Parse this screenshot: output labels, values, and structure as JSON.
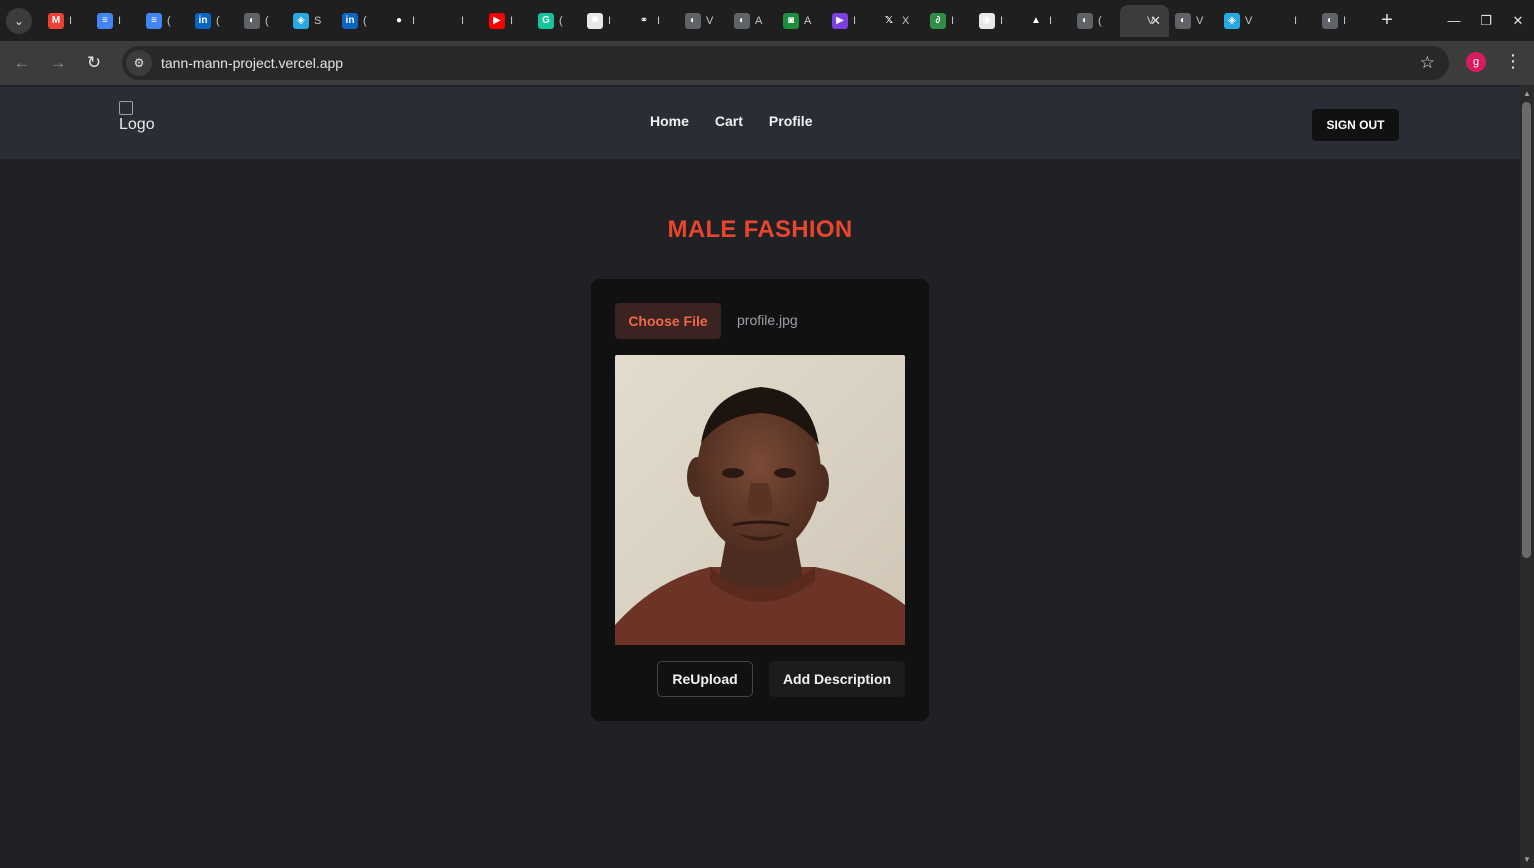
{
  "browser": {
    "tabs": [
      {
        "icon": "gmail-icon",
        "color": "#ea4335",
        "glyph": "M",
        "title": "I"
      },
      {
        "icon": "docs-icon",
        "color": "#4285f4",
        "glyph": "≡",
        "title": "I"
      },
      {
        "icon": "docs-icon",
        "color": "#4285f4",
        "glyph": "≡",
        "title": "("
      },
      {
        "icon": "linkedin-icon",
        "color": "#0a66c2",
        "glyph": "in",
        "title": "("
      },
      {
        "icon": "globe-icon",
        "color": "#5f6368",
        "glyph": "◐",
        "title": "("
      },
      {
        "icon": "app-icon",
        "color": "#29a9e1",
        "glyph": "◈",
        "title": "S"
      },
      {
        "icon": "linkedin-icon",
        "color": "#0a66c2",
        "glyph": "in",
        "title": "("
      },
      {
        "icon": "github-icon",
        "color": "#1f1f1f",
        "glyph": "●",
        "title": "I"
      },
      {
        "icon": "blank-icon",
        "color": "#1f1f1f",
        "glyph": "",
        "title": "I"
      },
      {
        "icon": "youtube-icon",
        "color": "#ff0000",
        "glyph": "▶",
        "title": "I"
      },
      {
        "icon": "grammarly-icon",
        "color": "#15c39a",
        "glyph": "G",
        "title": "("
      },
      {
        "icon": "openai-icon",
        "color": "#e8e8e8",
        "glyph": "✺",
        "title": "I"
      },
      {
        "icon": "link-icon",
        "color": "#1f1f1f",
        "glyph": "⚭",
        "title": "I"
      },
      {
        "icon": "globe-icon",
        "color": "#5f6368",
        "glyph": "◐",
        "title": "V"
      },
      {
        "icon": "globe-icon",
        "color": "#5f6368",
        "glyph": "◐",
        "title": "A"
      },
      {
        "icon": "android-icon",
        "color": "#1e8e3e",
        "glyph": "◙",
        "title": "A"
      },
      {
        "icon": "video-icon",
        "color": "#7b3fe4",
        "glyph": "▶",
        "title": "I"
      },
      {
        "icon": "x-icon",
        "color": "#1f1f1f",
        "glyph": "𝕏",
        "title": "X"
      },
      {
        "icon": "gfg-icon",
        "color": "#2f8d46",
        "glyph": "∂",
        "title": "I"
      },
      {
        "icon": "chrome-icon",
        "color": "#e8e8e8",
        "glyph": "◉",
        "title": "I"
      },
      {
        "icon": "vercel-icon",
        "color": "#1f1f1f",
        "glyph": "▲",
        "title": "I"
      },
      {
        "icon": "globe-icon",
        "color": "#5f6368",
        "glyph": "◐",
        "title": "("
      },
      {
        "icon": "blank-icon",
        "color": "#3c3c3c",
        "glyph": "",
        "title": "V",
        "active": true
      },
      {
        "icon": "globe-icon",
        "color": "#5f6368",
        "glyph": "◐",
        "title": "V"
      },
      {
        "icon": "app-icon",
        "color": "#29a9e1",
        "glyph": "◈",
        "title": "V"
      },
      {
        "icon": "blank-icon",
        "color": "#1f1f1f",
        "glyph": "",
        "title": "I"
      },
      {
        "icon": "globe-icon",
        "color": "#5f6368",
        "glyph": "◐",
        "title": "I"
      }
    ],
    "url": "tann-mann-project.vercel.app",
    "profile_initial": "g"
  },
  "site": {
    "logo_alt": "Logo",
    "nav": {
      "home": "Home",
      "cart": "Cart",
      "profile": "Profile"
    },
    "signout": "SIGN OUT",
    "title": "MALE FASHION"
  },
  "upload": {
    "choose_label": "Choose File",
    "file_name": "profile.jpg",
    "reupload_label": "ReUpload",
    "add_description_label": "Add Description"
  },
  "colors": {
    "accent": "#e8452c",
    "nav_bg": "#2a2d35",
    "page_bg": "#202124"
  }
}
